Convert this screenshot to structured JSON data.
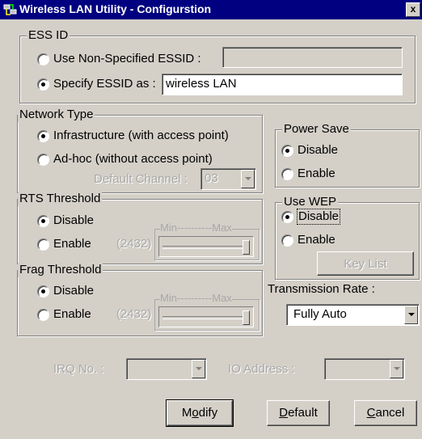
{
  "window": {
    "title": "Wireless LAN Utility - Configurstion",
    "close_label": "x"
  },
  "ess": {
    "legend": "ESS ID",
    "nonspec_label": "Use Non-Specified ESSID :",
    "nonspec_value": "",
    "specify_label": "Specify ESSID as :",
    "specify_value": "wireless LAN",
    "selected": "specify"
  },
  "network": {
    "legend": "Network Type",
    "infra_label": "Infrastructure (with access point)",
    "adhoc_label": "Ad-hoc (without access point)",
    "channel_label": "Default Channel :",
    "channel_value": "03",
    "selected": "infrastructure"
  },
  "power": {
    "legend": "Power Save",
    "disable_label": "Disable",
    "enable_label": "Enable",
    "selected": "disable"
  },
  "rts": {
    "legend": "RTS Threshold",
    "disable_label": "Disable",
    "enable_label": "Enable",
    "value_label": "(2432)",
    "minmax_label": "Min----------Max",
    "selected": "disable",
    "level": 1.0
  },
  "wep": {
    "legend": "Use WEP",
    "disable_label": "Disable",
    "enable_label": "Enable",
    "keylist_label": "Key List",
    "selected": "disable"
  },
  "frag": {
    "legend": "Frag Threshold",
    "disable_label": "Disable",
    "enable_label": "Enable",
    "value_label": "(2432)",
    "minmax_label": "Min----------Max",
    "selected": "disable",
    "level": 1.0
  },
  "rate": {
    "label": "Transmission Rate :",
    "value": "Fully Auto"
  },
  "irq": {
    "label": "IRQ No. :",
    "value": ""
  },
  "io": {
    "label": "IO Address :",
    "value": ""
  },
  "buttons": {
    "modify_pre": "M",
    "modify_ul": "o",
    "modify_post": "dify",
    "default_ul": "D",
    "default_post": "efault",
    "cancel_ul": "C",
    "cancel_post": "ancel"
  }
}
